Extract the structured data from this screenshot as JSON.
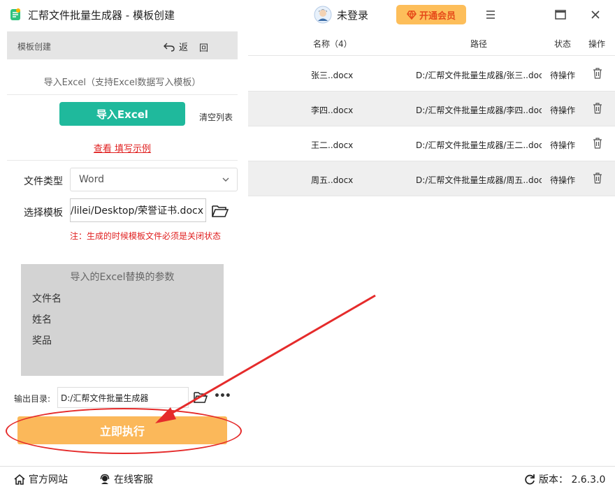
{
  "window": {
    "title": "汇帮文件批量生成器 - 模板创建",
    "login_text": "未登录",
    "vip_label": "开通会员"
  },
  "left": {
    "header_title": "模板创建",
    "back_label": "返",
    "back_label2": "回",
    "import_hint": "导入Excel（支持Excel数据写入模板）",
    "import_button": "导入Excel",
    "clear_button": "清空列表",
    "example_link": "查看 填写示例",
    "file_type_label": "文件类型",
    "file_type_value": "Word",
    "template_label": "选择模板",
    "template_value": "/lilei/Desktop/荣誉证书.docx",
    "warning": "注：生成的时候模板文件必须是关闭状态",
    "params_title": "导入的Excel替换的参数",
    "params": [
      "文件名",
      "姓名",
      "奖品"
    ],
    "output_label": "输出目录:",
    "output_value": "D:/汇帮文件批量生成器",
    "more_label": "•••",
    "run_button": "立即执行"
  },
  "table": {
    "headers": {
      "name": "名称（4）",
      "path": "路径",
      "status": "状态",
      "action": "操作"
    },
    "rows": [
      {
        "name": "张三..docx",
        "path": "D:/汇帮文件批量生成器/张三..docx",
        "status": "待操作"
      },
      {
        "name": "李四..docx",
        "path": "D:/汇帮文件批量生成器/李四..docx",
        "status": "待操作"
      },
      {
        "name": "王二..docx",
        "path": "D:/汇帮文件批量生成器/王二..docx",
        "status": "待操作"
      },
      {
        "name": "周五..docx",
        "path": "D:/汇帮文件批量生成器/周五..docx",
        "status": "待操作"
      }
    ]
  },
  "bottom": {
    "website": "官方网站",
    "support": "在线客服",
    "version": "版本：  2.6.3.0"
  },
  "colors": {
    "accent_green": "#1fb99c",
    "accent_orange": "#fbb85a",
    "warning_red": "#e02020",
    "annotation_red": "#e52b2b"
  }
}
